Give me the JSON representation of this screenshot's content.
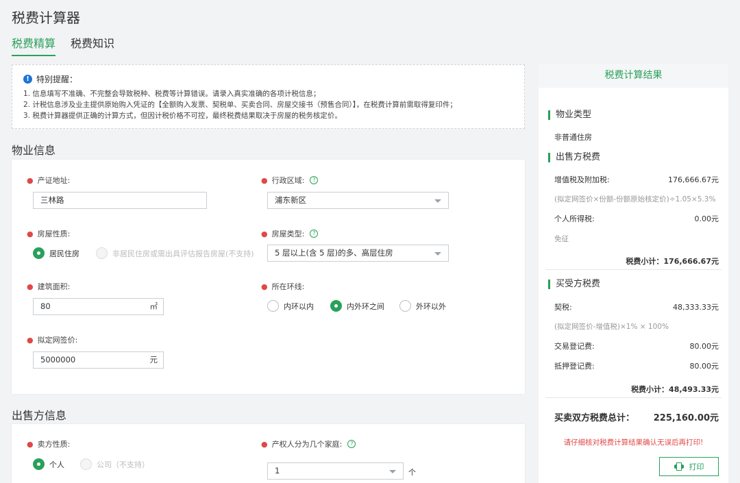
{
  "app_title": "税费计算器",
  "tabs": [
    {
      "label": "税费精算"
    },
    {
      "label": "税费知识"
    }
  ],
  "notice": {
    "title": "特别提醒：",
    "lines": [
      "1. 信息填写不准确、不完整会导致税种、税费等计算错误。请录入真实准确的各项计税信息；",
      "2. 计税信息涉及业主提供原始购入凭证的【全额购入发票、契税单、买卖合同、房屋交接书（预售合同）】，在税费计算前需取得复印件；",
      "3. 税费计算器提供正确的计算方式，但因计税价格不可控，最终税费结果取决于房屋的税务核定价。"
    ]
  },
  "property": {
    "section_title": "物业信息",
    "address": {
      "label": "产证地址:",
      "value": "三林路"
    },
    "district": {
      "label": "行政区域:",
      "value": "浦东新区"
    },
    "nature": {
      "label": "房屋性质:",
      "option1": "居民住房",
      "option2": "非居民住房或需出具评估报告房屋(不支持)"
    },
    "house_type": {
      "label": "房屋类型:",
      "value": "5 层以上(含 5 层)的多、高层住房"
    },
    "area": {
      "label": "建筑面积:",
      "value": "80",
      "unit": "㎡"
    },
    "ring": {
      "label": "所在环线:",
      "option1": "内环以内",
      "option2": "内外环之间",
      "option3": "外环以外"
    },
    "price": {
      "label": "拟定网签价:",
      "value": "5000000",
      "unit": "元"
    }
  },
  "seller": {
    "section_title": "出售方信息",
    "nature": {
      "label": "卖方性质:",
      "option1": "个人",
      "option2": "公司（不支持）"
    },
    "families": {
      "label": "产权人分为几个家庭:",
      "value": "1",
      "unit": "个"
    }
  },
  "result": {
    "title": "税费计算结果",
    "property_type_label": "物业类型",
    "property_type_value": "非普通住房",
    "seller_label": "出售方税费",
    "vat_label": "增值税及附加税:",
    "vat_value": "176,666.67元",
    "vat_note": "(拟定网签价×份额-份额原始核定价)÷1.05×5.3%",
    "income_label": "个人所得税:",
    "income_value": "0.00元",
    "income_note": "免征",
    "seller_subtotal": "税费小计：176,666.67元",
    "buyer_label": "买受方税费",
    "deed_label": "契税:",
    "deed_value": "48,333.33元",
    "deed_note": "(拟定网签价-增值税)×1% × 100%",
    "trade_reg_label": "交易登记费:",
    "trade_reg_value": "80.00元",
    "mortgage_reg_label": "抵押登记费:",
    "mortgage_reg_value": "80.00元",
    "buyer_subtotal": "税费小计：48,493.33元",
    "total_label": "买卖双方税费总计：",
    "total_value": "225,160.00元",
    "warning": "请仔细核对税费计算结果确认无误后再打印!",
    "print_label": "打印"
  },
  "colors": {
    "accent": "#2aa05b",
    "required": "#e04848",
    "info": "#1d74d6"
  }
}
